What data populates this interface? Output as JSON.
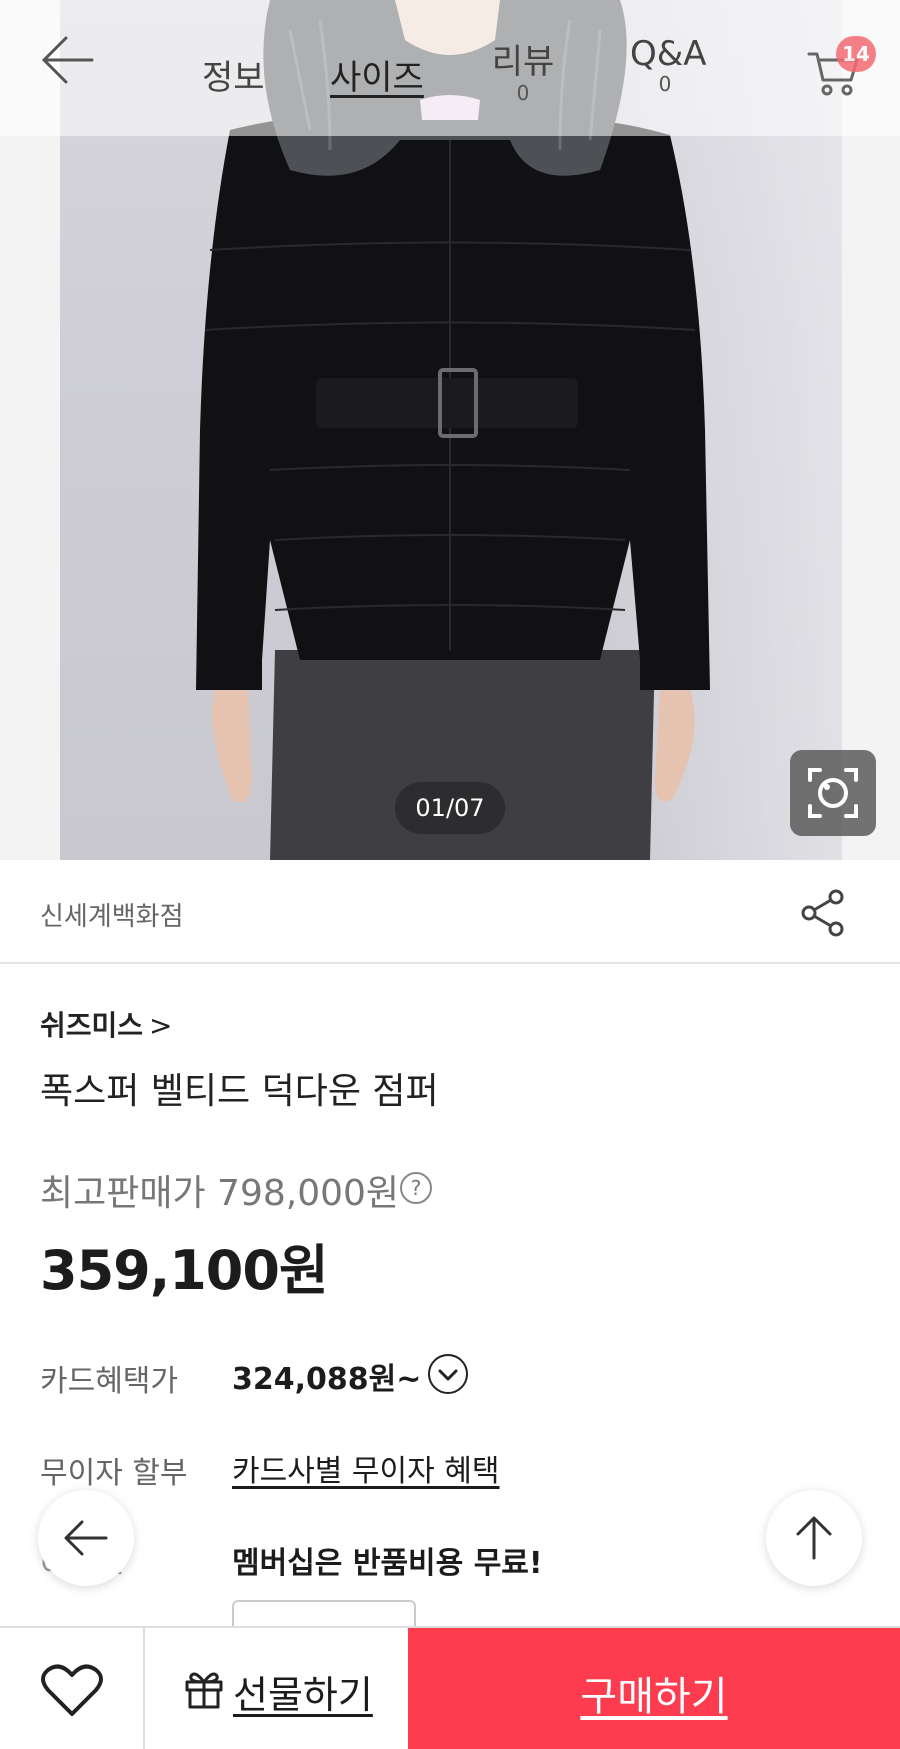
{
  "nav": {
    "tabs": [
      {
        "label": "정보"
      },
      {
        "label": "사이즈"
      },
      {
        "label": "리뷰",
        "count": "0"
      },
      {
        "label": "Q&A",
        "count": "0"
      }
    ],
    "cart_count": "14"
  },
  "gallery": {
    "counter": "01/07"
  },
  "store": {
    "name": "신세계백화점"
  },
  "product": {
    "brand": "쉬즈미스",
    "brand_chevron": ">",
    "name": "폭스퍼 벨티드 덕다운 점퍼",
    "original_price": "최고판매가 798,000원",
    "sale_price": "359,100원"
  },
  "benefits": {
    "card_label": "카드혜택가",
    "card_value": "324,088원~",
    "installment_label": "무이자 할부",
    "installment_value": "카드사별 무이자 혜택",
    "event_label": "이벤트",
    "event_value": "멤버십은 반품비용 무료!"
  },
  "bottom_bar": {
    "gift_label": "선물하기",
    "buy_label": "구매하기"
  },
  "colors": {
    "buy_button": "#fd3c4f",
    "cart_badge": "#f36a72"
  }
}
